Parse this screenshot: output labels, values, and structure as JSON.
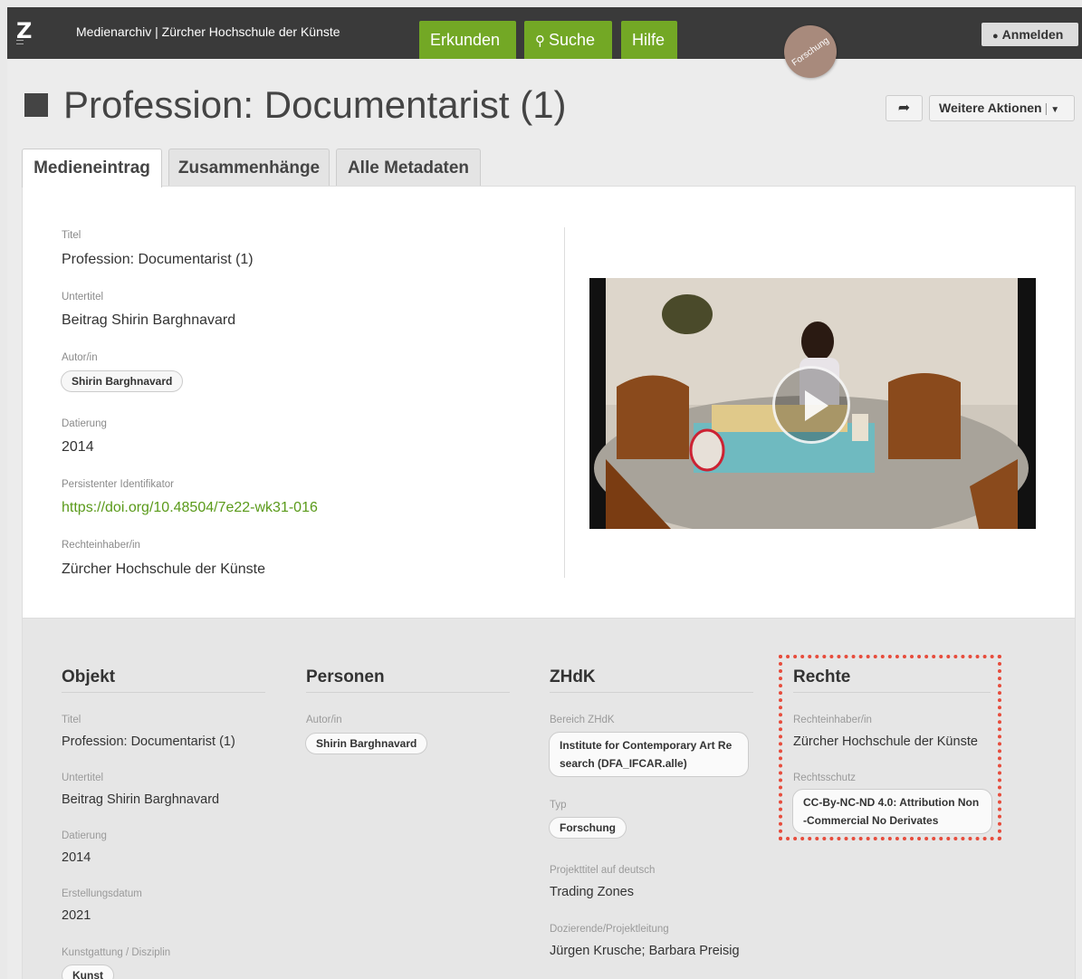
{
  "header": {
    "logo": "Z",
    "site_title": "Medienarchiv | Zürcher Hochschule der Künste",
    "nav": {
      "explore": "Erkunden",
      "search": "Suche",
      "help": "Hilfe"
    },
    "login": "Anmelden",
    "badge": "Forschung"
  },
  "page": {
    "title": "Profession: Documentarist (1)",
    "more_actions": "Weitere Aktionen"
  },
  "tabs": [
    "Medieneintrag",
    "Zusammenhänge",
    "Alle Metadaten"
  ],
  "summary": {
    "title_label": "Titel",
    "title": "Profession: Documentarist (1)",
    "subtitle_label": "Untertitel",
    "subtitle": "Beitrag Shirin Barghnavard",
    "author_label": "Autor/in",
    "author": "Shirin Barghnavard",
    "date_label": "Datierung",
    "date": "2014",
    "pid_label": "Persistenter Identifikator",
    "pid": "https://doi.org/10.48504/7e22-wk31-016",
    "rights_holder_label": "Rechteinhaber/in",
    "rights_holder": "Zürcher Hochschule der Künste"
  },
  "objekt": {
    "heading": "Objekt",
    "title_label": "Titel",
    "title": "Profession: Documentarist (1)",
    "subtitle_label": "Untertitel",
    "subtitle": "Beitrag Shirin Barghnavard",
    "date_label": "Datierung",
    "date": "2014",
    "created_label": "Erstellungsdatum",
    "created": "2021",
    "genre_label": "Kunstgattung / Disziplin",
    "genre": "Kunst"
  },
  "personen": {
    "heading": "Personen",
    "author_label": "Autor/in",
    "author": "Shirin Barghnavard"
  },
  "zhdk": {
    "heading": "ZHdK",
    "area_label": "Bereich ZHdK",
    "area_line1": "Institute for Contemporary Art Re",
    "area_line2": "search (DFA_IFCAR.alle)",
    "type_label": "Typ",
    "type": "Forschung",
    "project_label": "Projekttitel auf deutsch",
    "project": "Trading Zones",
    "lead_label": "Dozierende/Projektleitung",
    "lead": "Jürgen Krusche; Barbara Preisig"
  },
  "rechte": {
    "heading": "Rechte",
    "holder_label": "Rechteinhaber/in",
    "holder": "Zürcher Hochschule der Künste",
    "license_label": "Rechtsschutz",
    "license_line1": "CC-By-NC-ND 4.0: Attribution Non",
    "license_line2": "-Commercial No Derivates"
  },
  "colors": {
    "accent": "#73a825",
    "highlight": "#e74c3c",
    "topbar": "#3a3a3a"
  }
}
